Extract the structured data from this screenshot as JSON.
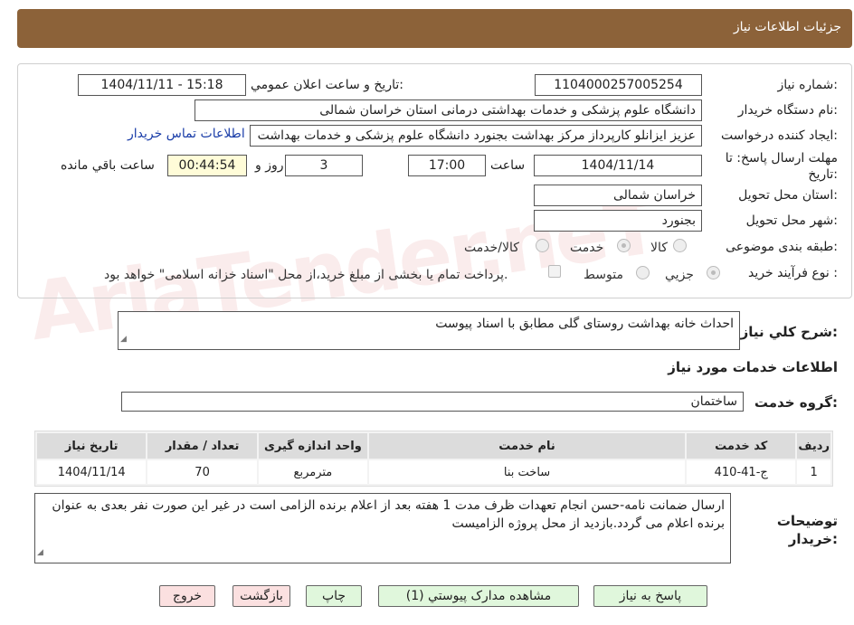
{
  "header": {
    "title": "جزئیات اطلاعات نیاز"
  },
  "form": {
    "need_number_label": "شماره نیاز:",
    "need_number": "1104000257005254",
    "announce_label": "تاریخ و ساعت اعلان عمومي:",
    "announce_value": "1404/11/11 - 15:18",
    "buyer_org_label": "نام دستگاه خریدار:",
    "buyer_org": "دانشگاه علوم پزشکی و خدمات بهداشتی درمانی استان خراسان شمالی",
    "requester_label": "ایجاد کننده درخواست:",
    "requester": "عزیز ایزانلو کارپرداز مرکز بهداشت بجنورد دانشگاه علوم پزشکی و خدمات بهداشت",
    "contact_link": "اطلاعات تماس خریدار",
    "deadline_label": "مهلت ارسال پاسخ: تا تاریخ:",
    "deadline_date": "1404/11/14",
    "time_label": "ساعت",
    "deadline_time": "17:00",
    "days_value": "3",
    "days_label": "روز و",
    "remaining_time": "00:44:54",
    "remaining_label": "ساعت باقي مانده",
    "province_label": "استان محل تحویل:",
    "province": "خراسان شمالی",
    "city_label": "شهر محل تحویل:",
    "city": "بجنورد",
    "category_label": "طبقه بندی موضوعی:",
    "category_options": [
      "کالا",
      "خدمت",
      "کالا/خدمت"
    ],
    "process_label": "نوع فرآیند خرید :",
    "process_options": [
      "جزيي",
      "متوسط"
    ],
    "payment_note": "پرداخت تمام یا بخشی از مبلغ خرید،از محل \"اسناد خزانه اسلامی\" خواهد بود."
  },
  "description": {
    "label": "شرح کلي نیاز:",
    "value": "احداث خانه بهداشت روستای گلی مطابق با اسناد پیوست"
  },
  "services": {
    "section_title": "اطلاعات خدمات مورد نیاز",
    "group_label": "گروه خدمت:",
    "group_value": "ساختمان",
    "columns": [
      "ردیف",
      "کد خدمت",
      "نام خدمت",
      "واحد اندازه گیری",
      "تعداد / مقدار",
      "تاریخ نیاز"
    ],
    "rows": [
      {
        "row": "1",
        "code": "ج-41-410",
        "name": "ساخت بنا",
        "unit": "مترمربع",
        "qty": "70",
        "date": "1404/11/14"
      }
    ]
  },
  "buyer_notes": {
    "label": "توضیحات خریدار:",
    "value": "ارسال ضمانت نامه-حسن انجام تعهدات ظرف مدت 1 هفته بعد از اعلام برنده الزامی است در غیر این صورت نفر بعدی به عنوان برنده اعلام می گردد.بازدید از محل پروژه الزامیست"
  },
  "buttons": {
    "reply": "پاسخ به نیاز",
    "attachments": "مشاهده مدارک پیوستي (1)",
    "print": "چاپ",
    "back": "بازگشت",
    "exit": "خروج"
  },
  "watermark": "AriaTender.neT",
  "colors": {
    "header_bg": "#8c6239",
    "button_green": "#e0f7dc",
    "button_pink": "#fbe0e0",
    "link": "#1a3da8"
  }
}
